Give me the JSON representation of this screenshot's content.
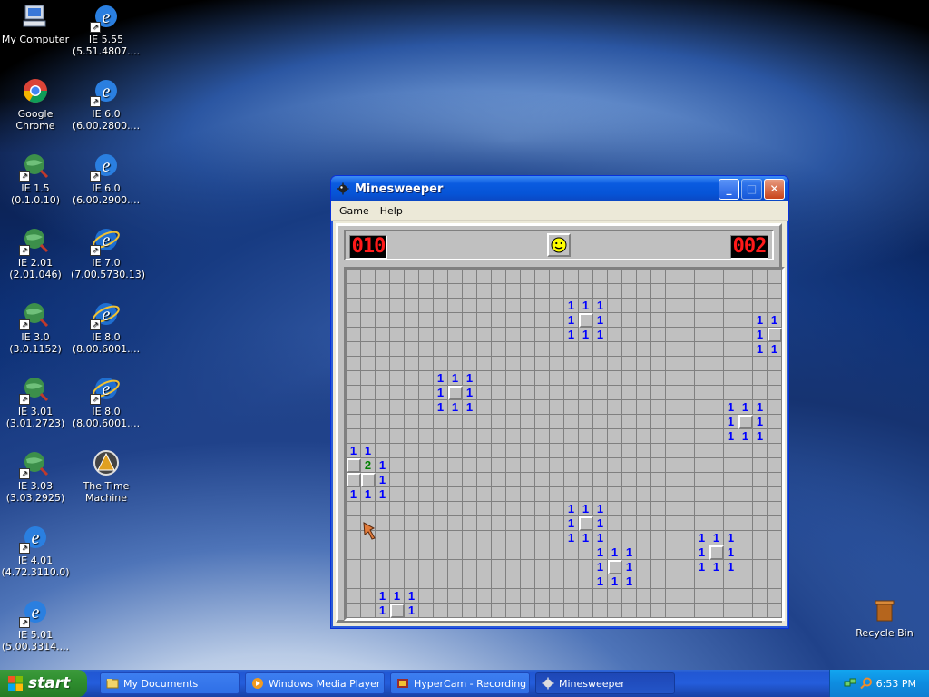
{
  "desktop": {
    "icons": [
      {
        "label": "My Computer",
        "icon": "my-computer-icon"
      },
      {
        "label": "IE 5.55 (5.51.4807....",
        "icon": "ie-icon"
      },
      {
        "label": "Google Chrome",
        "icon": "chrome-icon"
      },
      {
        "label": "IE 6.0 (6.00.2800....",
        "icon": "ie-icon"
      },
      {
        "label": "IE 1.5 (0.1.0.10)",
        "icon": "ie-globe-icon"
      },
      {
        "label": "IE 6.0 (6.00.2900....",
        "icon": "ie-icon"
      },
      {
        "label": "IE 2.01 (2.01.046)",
        "icon": "ie-globe-icon"
      },
      {
        "label": "IE 7.0 (7.00.5730.13)",
        "icon": "ie-icon"
      },
      {
        "label": "IE 3.0 (3.0.1152)",
        "icon": "ie-globe-icon"
      },
      {
        "label": "IE 8.0 (8.00.6001....",
        "icon": "ie-icon"
      },
      {
        "label": "IE 3.01 (3.01.2723)",
        "icon": "ie-globe-icon"
      },
      {
        "label": "IE 8.0 (8.00.6001....",
        "icon": "ie-icon"
      },
      {
        "label": "IE 3.03 (3.03.2925)",
        "icon": "ie-globe-icon"
      },
      {
        "label": "The Time Machine",
        "icon": "time-machine-icon"
      },
      {
        "label": "IE 4.01 (4.72.3110.0)",
        "icon": "ie-icon"
      },
      {
        "label": "IE 5.01 (5.00.3314....",
        "icon": "ie-icon"
      },
      {
        "label": "Recycle Bin",
        "icon": "recycle-bin-icon"
      }
    ]
  },
  "window": {
    "title": "Minesweeper",
    "menu": [
      "Game",
      "Help"
    ],
    "mine_counter": "010",
    "timer": "002"
  },
  "board": {
    "cols": 30,
    "rows": 24,
    "cells": [
      {
        "r": 2,
        "c": 15,
        "v": "1"
      },
      {
        "r": 2,
        "c": 16,
        "v": "1"
      },
      {
        "r": 2,
        "c": 17,
        "v": "1"
      },
      {
        "r": 3,
        "c": 15,
        "v": "1"
      },
      {
        "r": 3,
        "c": 16,
        "v": "raised"
      },
      {
        "r": 3,
        "c": 17,
        "v": "1"
      },
      {
        "r": 4,
        "c": 15,
        "v": "1"
      },
      {
        "r": 4,
        "c": 16,
        "v": "1"
      },
      {
        "r": 4,
        "c": 17,
        "v": "1"
      },
      {
        "r": 3,
        "c": 28,
        "v": "1"
      },
      {
        "r": 3,
        "c": 29,
        "v": "1"
      },
      {
        "r": 4,
        "c": 28,
        "v": "1"
      },
      {
        "r": 4,
        "c": 29,
        "v": "raised"
      },
      {
        "r": 5,
        "c": 28,
        "v": "1"
      },
      {
        "r": 5,
        "c": 29,
        "v": "1"
      },
      {
        "r": 7,
        "c": 6,
        "v": "1"
      },
      {
        "r": 7,
        "c": 7,
        "v": "1"
      },
      {
        "r": 7,
        "c": 8,
        "v": "1"
      },
      {
        "r": 8,
        "c": 6,
        "v": "1"
      },
      {
        "r": 8,
        "c": 7,
        "v": "raised"
      },
      {
        "r": 8,
        "c": 8,
        "v": "1"
      },
      {
        "r": 9,
        "c": 6,
        "v": "1"
      },
      {
        "r": 9,
        "c": 7,
        "v": "1"
      },
      {
        "r": 9,
        "c": 8,
        "v": "1"
      },
      {
        "r": 9,
        "c": 26,
        "v": "1"
      },
      {
        "r": 9,
        "c": 27,
        "v": "1"
      },
      {
        "r": 9,
        "c": 28,
        "v": "1"
      },
      {
        "r": 10,
        "c": 26,
        "v": "1"
      },
      {
        "r": 10,
        "c": 27,
        "v": "raised"
      },
      {
        "r": 10,
        "c": 28,
        "v": "1"
      },
      {
        "r": 11,
        "c": 26,
        "v": "1"
      },
      {
        "r": 11,
        "c": 27,
        "v": "1"
      },
      {
        "r": 11,
        "c": 28,
        "v": "1"
      },
      {
        "r": 12,
        "c": 0,
        "v": "1"
      },
      {
        "r": 12,
        "c": 1,
        "v": "1"
      },
      {
        "r": 13,
        "c": 0,
        "v": "raised"
      },
      {
        "r": 13,
        "c": 1,
        "v": "2"
      },
      {
        "r": 13,
        "c": 2,
        "v": "1"
      },
      {
        "r": 14,
        "c": 0,
        "v": "raised"
      },
      {
        "r": 14,
        "c": 1,
        "v": "raised"
      },
      {
        "r": 14,
        "c": 2,
        "v": "1"
      },
      {
        "r": 15,
        "c": 0,
        "v": "1"
      },
      {
        "r": 15,
        "c": 1,
        "v": "1"
      },
      {
        "r": 15,
        "c": 2,
        "v": "1"
      },
      {
        "r": 16,
        "c": 15,
        "v": "1"
      },
      {
        "r": 16,
        "c": 16,
        "v": "1"
      },
      {
        "r": 16,
        "c": 17,
        "v": "1"
      },
      {
        "r": 17,
        "c": 15,
        "v": "1"
      },
      {
        "r": 17,
        "c": 16,
        "v": "raised"
      },
      {
        "r": 17,
        "c": 17,
        "v": "1"
      },
      {
        "r": 18,
        "c": 15,
        "v": "1"
      },
      {
        "r": 18,
        "c": 16,
        "v": "1"
      },
      {
        "r": 18,
        "c": 17,
        "v": "1"
      },
      {
        "r": 18,
        "c": 24,
        "v": "1"
      },
      {
        "r": 18,
        "c": 25,
        "v": "1"
      },
      {
        "r": 18,
        "c": 26,
        "v": "1"
      },
      {
        "r": 19,
        "c": 17,
        "v": "1"
      },
      {
        "r": 19,
        "c": 18,
        "v": "1"
      },
      {
        "r": 19,
        "c": 19,
        "v": "1"
      },
      {
        "r": 19,
        "c": 24,
        "v": "1"
      },
      {
        "r": 19,
        "c": 25,
        "v": "raised"
      },
      {
        "r": 19,
        "c": 26,
        "v": "1"
      },
      {
        "r": 20,
        "c": 17,
        "v": "1"
      },
      {
        "r": 20,
        "c": 18,
        "v": "raised"
      },
      {
        "r": 20,
        "c": 19,
        "v": "1"
      },
      {
        "r": 20,
        "c": 24,
        "v": "1"
      },
      {
        "r": 20,
        "c": 25,
        "v": "1"
      },
      {
        "r": 20,
        "c": 26,
        "v": "1"
      },
      {
        "r": 21,
        "c": 17,
        "v": "1"
      },
      {
        "r": 21,
        "c": 18,
        "v": "1"
      },
      {
        "r": 21,
        "c": 19,
        "v": "1"
      },
      {
        "r": 22,
        "c": 2,
        "v": "1"
      },
      {
        "r": 22,
        "c": 3,
        "v": "1"
      },
      {
        "r": 22,
        "c": 4,
        "v": "1"
      },
      {
        "r": 23,
        "c": 2,
        "v": "1"
      },
      {
        "r": 23,
        "c": 3,
        "v": "raised"
      },
      {
        "r": 23,
        "c": 4,
        "v": "1"
      }
    ]
  },
  "taskbar": {
    "start_label": "start",
    "tasks": [
      {
        "label": "My Documents",
        "icon": "folder-icon"
      },
      {
        "label": "Windows Media Player",
        "icon": "media-player-icon"
      },
      {
        "label": "HyperCam - Recording",
        "icon": "hypercam-icon"
      },
      {
        "label": "Minesweeper",
        "icon": "minesweeper-icon"
      }
    ],
    "clock": "6:53 PM"
  },
  "colors": {
    "lcd": "#ff1a1a",
    "number_1": "#0000ff",
    "number_2": "#008000",
    "taskbar": "#245ddb",
    "start": "#2f8f2f"
  }
}
